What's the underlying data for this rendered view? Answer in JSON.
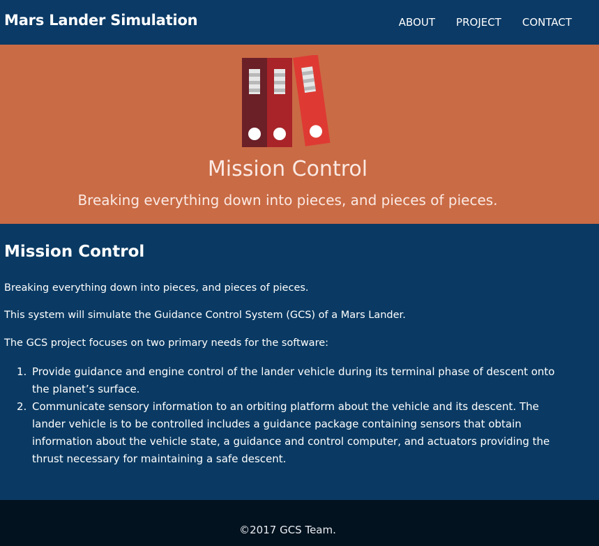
{
  "navbar": {
    "brand": "Mars Lander Simulation",
    "links": [
      "ABOUT",
      "PROJECT",
      "CONTACT"
    ]
  },
  "hero": {
    "graphic": "binders-icon",
    "title": "Mission Control",
    "subtitle": "Breaking everything down into pieces, and pieces of pieces."
  },
  "content": {
    "heading": "Mission Control",
    "paragraphs": [
      "Breaking everything down into pieces, and pieces of pieces.",
      "This system will simulate the Guidance Control System (GCS) of a Mars Lander.",
      "The GCS project focuses on two primary needs for the software:"
    ],
    "needs": [
      {
        "number": "1.",
        "lines": [
          "Provide guidance and engine control of the lander vehicle during its terminal phase of descent onto",
          "the planet’s surface."
        ]
      },
      {
        "number": "2.",
        "lines": [
          "Communicate sensory information to an orbiting platform about the vehicle and its descent. The",
          "lander vehicle is to be controlled includes a guidance package containing sensors that obtain",
          "information about the vehicle state, a guidance and control computer, and actuators providing the",
          "thrust necessary for maintaining a safe descent."
        ]
      }
    ]
  },
  "footer": {
    "text": "©2017 GCS Team."
  },
  "colors": {
    "navbar_bg": "#0b3a66",
    "hero_bg": "#c96b45",
    "content_bg": "#0a3a63",
    "footer_bg": "#03121f",
    "binder_dark": "#6b1f27",
    "binder_mid": "#a82428",
    "binder_light": "#de3a33"
  }
}
